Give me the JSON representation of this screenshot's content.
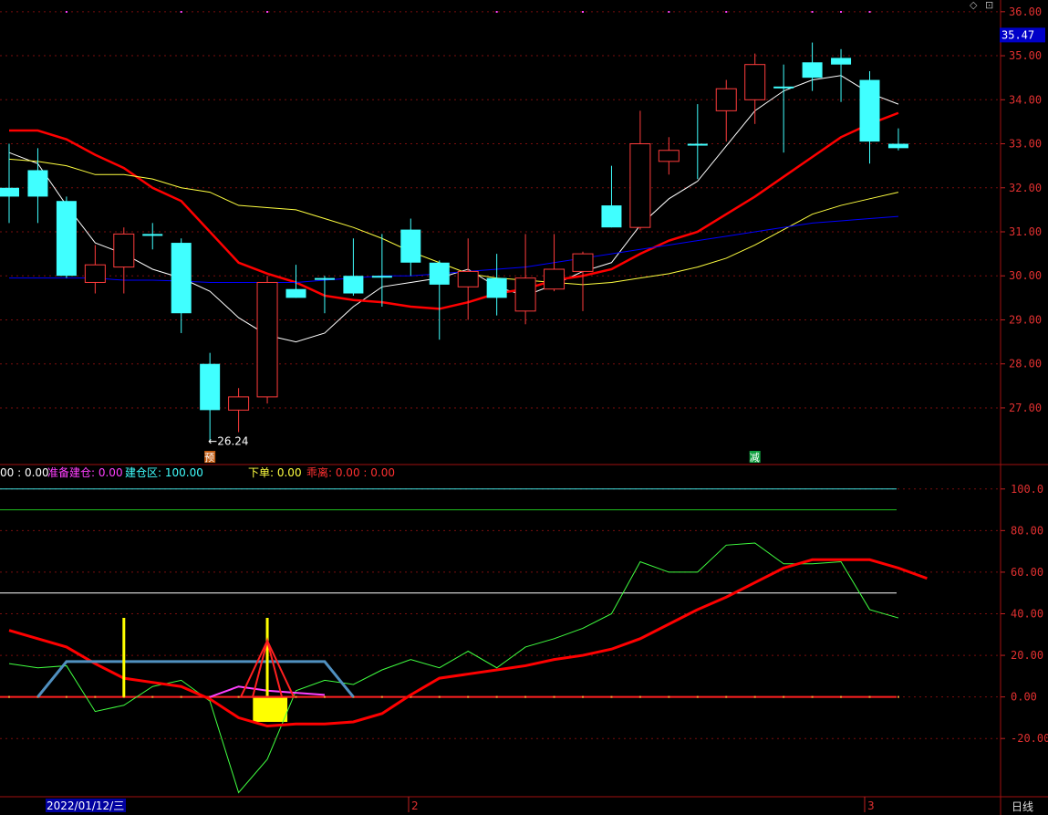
{
  "chart_data": [
    {
      "type": "candlestick",
      "price_axis": {
        "ticks": [
          "36.00",
          "35.00",
          "34.00",
          "33.00",
          "32.00",
          "31.00",
          "30.00",
          "29.00",
          "28.00",
          "27.00"
        ],
        "ylim": [
          25.9,
          36.1
        ],
        "current_price_label": "35.47",
        "current_price": 35.47
      },
      "candles": [
        {
          "o": 32.0,
          "h": 33.0,
          "l": 31.2,
          "c": 31.8
        },
        {
          "o": 32.4,
          "h": 32.9,
          "l": 31.2,
          "c": 31.8
        },
        {
          "o": 31.7,
          "h": 31.8,
          "l": 29.95,
          "c": 30.0
        },
        {
          "o": 29.85,
          "h": 30.7,
          "l": 29.6,
          "c": 30.25
        },
        {
          "o": 30.2,
          "h": 31.1,
          "l": 29.6,
          "c": 30.95
        },
        {
          "o": 30.95,
          "h": 31.2,
          "l": 30.6,
          "c": 30.95
        },
        {
          "o": 30.75,
          "h": 30.85,
          "l": 28.7,
          "c": 29.15
        },
        {
          "o": 28.0,
          "h": 28.25,
          "l": 26.24,
          "c": 26.95
        },
        {
          "o": 26.95,
          "h": 27.45,
          "l": 26.45,
          "c": 27.25
        },
        {
          "o": 27.25,
          "h": 30.0,
          "l": 27.1,
          "c": 29.85
        },
        {
          "o": 29.7,
          "h": 30.25,
          "l": 29.5,
          "c": 29.5
        },
        {
          "o": 29.95,
          "h": 30.0,
          "l": 29.15,
          "c": 29.95
        },
        {
          "o": 30.0,
          "h": 30.85,
          "l": 29.55,
          "c": 29.6
        },
        {
          "o": 30.0,
          "h": 30.95,
          "l": 29.3,
          "c": 30.0
        },
        {
          "o": 31.05,
          "h": 31.3,
          "l": 30.0,
          "c": 30.3
        },
        {
          "o": 30.3,
          "h": 30.35,
          "l": 28.55,
          "c": 29.8
        },
        {
          "o": 29.75,
          "h": 30.85,
          "l": 29.0,
          "c": 30.1
        },
        {
          "o": 29.95,
          "h": 30.5,
          "l": 29.1,
          "c": 29.5
        },
        {
          "o": 29.2,
          "h": 30.95,
          "l": 28.9,
          "c": 29.95
        },
        {
          "o": 29.7,
          "h": 30.95,
          "l": 29.65,
          "c": 30.15
        },
        {
          "o": 30.1,
          "h": 30.55,
          "l": 29.2,
          "c": 30.5
        },
        {
          "o": 31.6,
          "h": 32.5,
          "l": 31.1,
          "c": 31.1
        },
        {
          "o": 31.1,
          "h": 33.75,
          "l": 31.05,
          "c": 33.0
        },
        {
          "o": 32.6,
          "h": 33.15,
          "l": 32.3,
          "c": 32.85
        },
        {
          "o": 33.0,
          "h": 33.9,
          "l": 32.2,
          "c": 33.0
        },
        {
          "o": 33.75,
          "h": 34.45,
          "l": 33.05,
          "c": 34.25
        },
        {
          "o": 34.0,
          "h": 35.05,
          "l": 33.45,
          "c": 34.8
        },
        {
          "o": 34.3,
          "h": 34.8,
          "l": 32.8,
          "c": 34.3
        },
        {
          "o": 34.85,
          "h": 35.3,
          "l": 34.2,
          "c": 34.5
        },
        {
          "o": 34.95,
          "h": 35.15,
          "l": 33.95,
          "c": 34.8
        },
        {
          "o": 34.45,
          "h": 34.65,
          "l": 32.55,
          "c": 33.05
        },
        {
          "o": 33.0,
          "h": 33.35,
          "l": 32.85,
          "c": 32.9
        }
      ],
      "ma_series": [
        {
          "color": "#ffffff",
          "values": [
            32.8,
            32.55,
            31.6,
            30.75,
            30.5,
            30.15,
            29.95,
            29.65,
            29.05,
            28.65,
            28.5,
            28.7,
            29.3,
            29.75,
            29.85,
            29.95,
            30.15,
            29.75,
            29.55,
            29.8,
            30.1,
            30.3,
            31.15,
            31.75,
            32.15,
            32.95,
            33.75,
            34.2,
            34.45,
            34.55,
            34.15,
            33.9
          ]
        },
        {
          "color": "#ff0000",
          "values": [
            33.3,
            33.3,
            33.1,
            32.75,
            32.45,
            32.0,
            31.7,
            31.0,
            30.3,
            30.05,
            29.85,
            29.55,
            29.45,
            29.4,
            29.3,
            29.25,
            29.4,
            29.6,
            29.7,
            29.9,
            30.0,
            30.15,
            30.5,
            30.8,
            31.0,
            31.4,
            31.8,
            32.25,
            32.7,
            33.15,
            33.45,
            33.7
          ]
        },
        {
          "color": "#ffff40",
          "values": [
            32.65,
            32.6,
            32.5,
            32.3,
            32.3,
            32.2,
            32.0,
            31.9,
            31.6,
            31.55,
            31.5,
            31.3,
            31.1,
            30.85,
            30.55,
            30.3,
            30.05,
            29.95,
            29.9,
            29.85,
            29.8,
            29.85,
            29.95,
            30.05,
            30.2,
            30.4,
            30.7,
            31.05,
            31.4,
            31.6,
            31.75,
            31.9
          ]
        },
        {
          "color": "#0000ff",
          "values": [
            29.95,
            29.95,
            29.95,
            29.95,
            29.9,
            29.9,
            29.88,
            29.85,
            29.85,
            29.85,
            29.85,
            29.9,
            29.95,
            30.0,
            30.0,
            30.05,
            30.1,
            30.15,
            30.2,
            30.3,
            30.4,
            30.5,
            30.6,
            30.7,
            30.8,
            30.9,
            31.0,
            31.1,
            31.2,
            31.25,
            31.3,
            31.35
          ]
        }
      ],
      "low_annotation": "←26.24",
      "markers": [
        {
          "text": "预",
          "candle": 7
        },
        {
          "text": "减",
          "candle": 26
        }
      ],
      "top_dots_at": [
        2,
        6,
        9,
        17,
        20,
        23,
        25,
        28,
        29,
        30
      ]
    },
    {
      "type": "line",
      "legend": [
        {
          "text": "00 : 0.00",
          "color": "#ffffff"
        },
        {
          "text": "准备建仓: 0.00",
          "color": "#ff40ff"
        },
        {
          "text": "建仓区: 100.00",
          "color": "#40ffff"
        },
        {
          "text": "下单: 0.00",
          "color": "#ffff40"
        },
        {
          "text": "乖离: 0.00 : 0.00",
          "color": "#ff3030"
        }
      ],
      "y_axis": {
        "ticks": [
          "100.0",
          "80.00",
          "60.00",
          "40.00",
          "20.00",
          "0.00",
          "-20.00"
        ],
        "ylim": [
          -48,
          110
        ]
      },
      "hlines": [
        {
          "value": 100,
          "color": "#40e0e0"
        },
        {
          "value": 90,
          "color": "#20c020"
        },
        {
          "value": 50,
          "color": "#ffffff"
        },
        {
          "value": 0,
          "color": "#ff2020"
        }
      ],
      "series": [
        {
          "color": "#40ff40",
          "values": [
            16,
            14,
            15,
            -7,
            -4,
            5,
            8,
            -2,
            -46,
            -30,
            3,
            8,
            6,
            13,
            18,
            14,
            22,
            14,
            24,
            28,
            33,
            40,
            65,
            60,
            60,
            73,
            74,
            64,
            64,
            65,
            42,
            38
          ]
        },
        {
          "color": "#ff0000",
          "values": [
            32,
            28,
            24,
            16,
            9,
            7,
            5,
            -1,
            -10,
            -14,
            -13,
            -13,
            -12,
            -8,
            1,
            9,
            11,
            13,
            15,
            18,
            20,
            23,
            28,
            35,
            42,
            48,
            55,
            62,
            66,
            66,
            66,
            62,
            57
          ]
        },
        {
          "color": "#ff40ff",
          "values": [
            null,
            null,
            null,
            null,
            null,
            null,
            null,
            0,
            5,
            3,
            2,
            1,
            null
          ]
        },
        {
          "color": "#5090c0",
          "values": [
            null,
            0,
            17,
            17,
            17,
            17,
            17,
            17,
            17,
            17,
            17,
            17,
            0
          ]
        }
      ],
      "yellow_spikes": [
        {
          "candle": 4,
          "value": 38
        },
        {
          "candle": 9,
          "value": 38
        }
      ],
      "yellow_bar": {
        "from": 8.5,
        "to": 9.7,
        "value": -12
      },
      "triangle": {
        "candle": 9,
        "apex": 27
      }
    }
  ],
  "xaxis": {
    "date_label": "2022/01/12/三",
    "month_marks": [
      "2",
      "3"
    ],
    "period_label": "日线"
  }
}
